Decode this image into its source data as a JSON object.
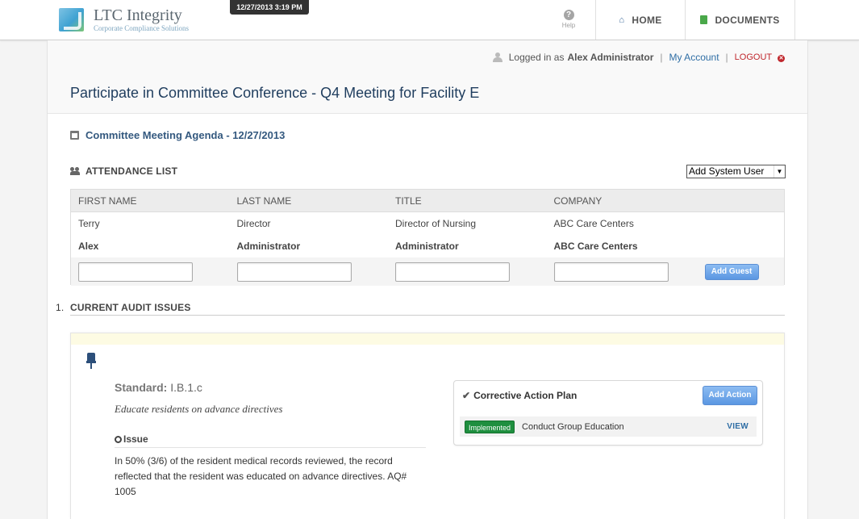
{
  "brand": {
    "title": "LTC Integrity",
    "subtitle": "Corporate Compliance Solutions"
  },
  "clock": "12/27/2013 3:19 PM",
  "nav": {
    "help": "Help",
    "home": "HOME",
    "documents": "DOCUMENTS"
  },
  "user": {
    "prefix": "Logged in as",
    "name": "Alex Administrator",
    "my_account": "My Account",
    "logout": "LOGOUT"
  },
  "page": {
    "title": "Participate in Committee Conference - Q4 Meeting for Facility E",
    "agenda": "Committee Meeting Agenda - 12/27/2013"
  },
  "attendance": {
    "heading": "ATTENDANCE LIST",
    "select_value": "Add System User",
    "columns": [
      "FIRST NAME",
      "LAST NAME",
      "TITLE",
      "COMPANY"
    ],
    "rows": [
      [
        "Terry",
        "Director",
        "Director of Nursing",
        "ABC Care Centers"
      ],
      [
        "Alex",
        "Administrator",
        "Administrator",
        "ABC Care Centers"
      ]
    ],
    "add_guest": "Add Guest"
  },
  "issues": {
    "number": "1.",
    "heading": "CURRENT AUDIT ISSUES",
    "standard_label": "Standard:",
    "standard_code": "I.B.1.c",
    "standard_desc": "Educate residents on advance directives",
    "issue_label": "Issue",
    "issue_text": "In 50% (3/6) of the resident medical records reviewed, the record reflected that the resident was educated on advance directives. AQ# 1005",
    "cap": {
      "title": "Corrective Action Plan",
      "add_action": "Add Action",
      "items": [
        {
          "status": "Implemented",
          "label": "Conduct Group Education",
          "link": "VIEW"
        }
      ]
    }
  },
  "colors": {
    "accent_blue": "#5b97e2",
    "title_navy": "#1f3d5e",
    "status_green": "#1f8f3f",
    "logout_red": "#c0272d"
  }
}
